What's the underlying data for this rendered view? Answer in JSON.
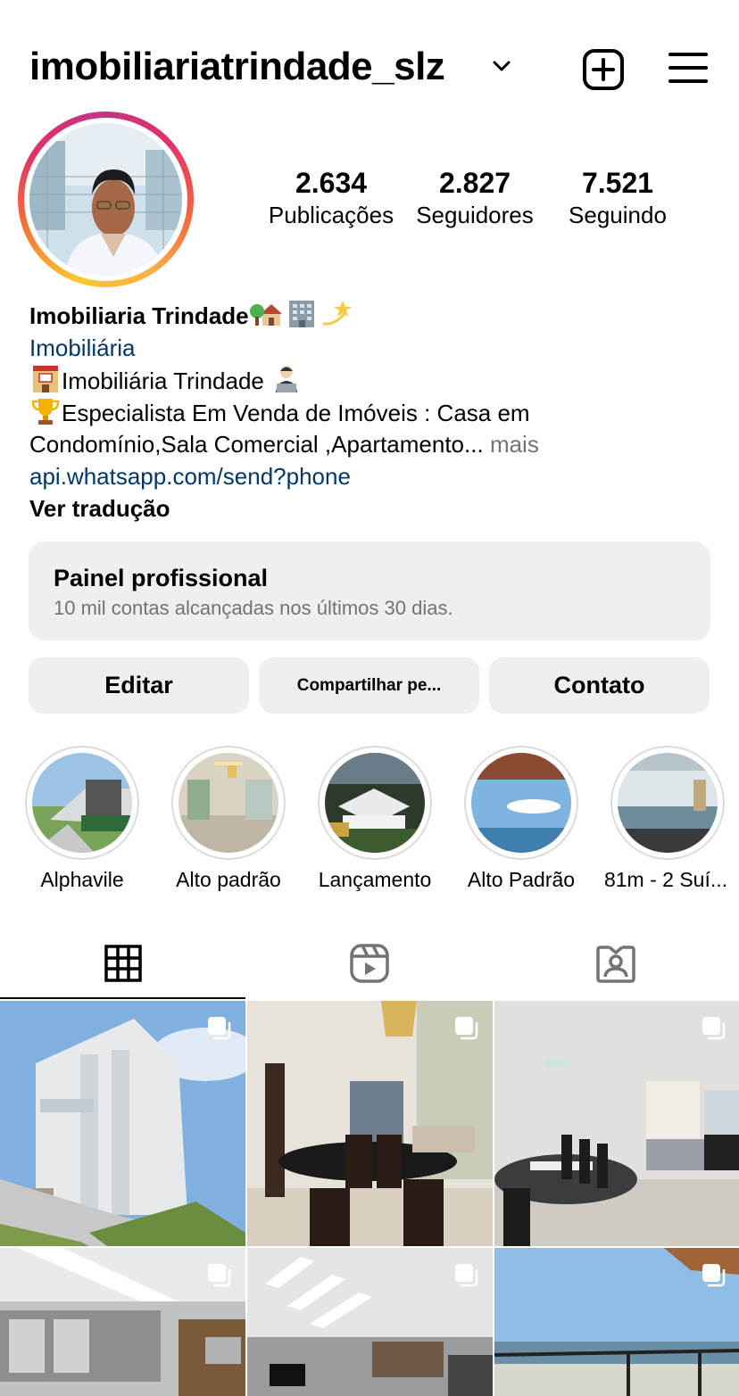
{
  "header": {
    "username": "imobiliariatrindade_slz",
    "icons": [
      "chevron-down-icon",
      "new-post-icon",
      "menu-icon"
    ]
  },
  "stats": [
    {
      "value": "2.634",
      "label": "Publicações"
    },
    {
      "value": "2.827",
      "label": "Seguidores"
    },
    {
      "value": "7.521",
      "label": "Seguindo"
    }
  ],
  "bio": {
    "name": "Imobiliaria Trindade",
    "category": "Imobiliária",
    "line1": "Imobiliária Trindade",
    "line2": "Especialista Em Venda de Imóveis : Casa em",
    "line3": "Condomínio,Sala Comercial ,Apartamento...",
    "more": "mais",
    "link": "api.whatsapp.com/send?phone",
    "translate": "Ver tradução"
  },
  "dashboard": {
    "title": "Painel profissional",
    "subtitle": "10 mil contas alcançadas nos últimos 30 dias."
  },
  "buttons": {
    "edit": "Editar",
    "share": "Compartilhar pe...",
    "contact": "Contato"
  },
  "highlights": [
    {
      "label": "Alphavile"
    },
    {
      "label": "Alto padrão"
    },
    {
      "label": "Lançamento"
    },
    {
      "label": "Alto Padrão"
    },
    {
      "label": "81m - 2 Suí..."
    }
  ],
  "tabs": [
    {
      "name": "posts-grid",
      "icon": "grid-icon",
      "active": true
    },
    {
      "name": "reels",
      "icon": "reels-icon",
      "active": false
    },
    {
      "name": "tagged",
      "icon": "tagged-icon",
      "active": false
    }
  ],
  "colors": {
    "link": "#00376b",
    "muted": "#737373",
    "panel": "#efefef",
    "highlight_ring": "#dbdbdb"
  }
}
